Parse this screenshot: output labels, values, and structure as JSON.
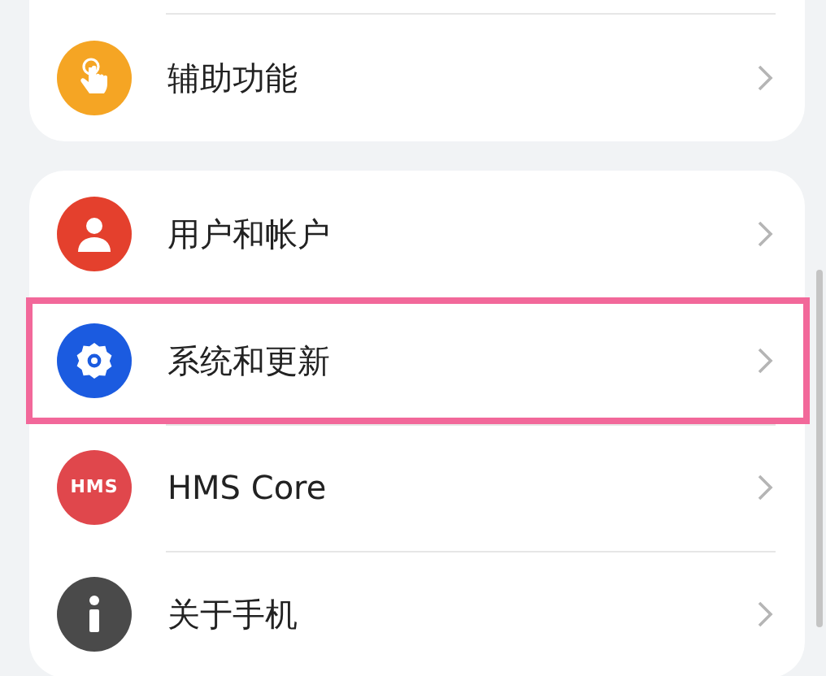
{
  "groups": [
    {
      "cut_top": true,
      "items": [
        {
          "kind": "accessibility",
          "label": "辅助功能",
          "highlighted": false
        }
      ]
    },
    {
      "cut_top": false,
      "items": [
        {
          "kind": "user",
          "label": "用户和帐户",
          "highlighted": false
        },
        {
          "kind": "system",
          "label": "系统和更新",
          "highlighted": true
        },
        {
          "kind": "logo",
          "icon_text": "HMS",
          "label": "HMS Core",
          "highlighted": false
        },
        {
          "kind": "info",
          "label": "关于手机",
          "highlighted": false
        }
      ]
    }
  ]
}
